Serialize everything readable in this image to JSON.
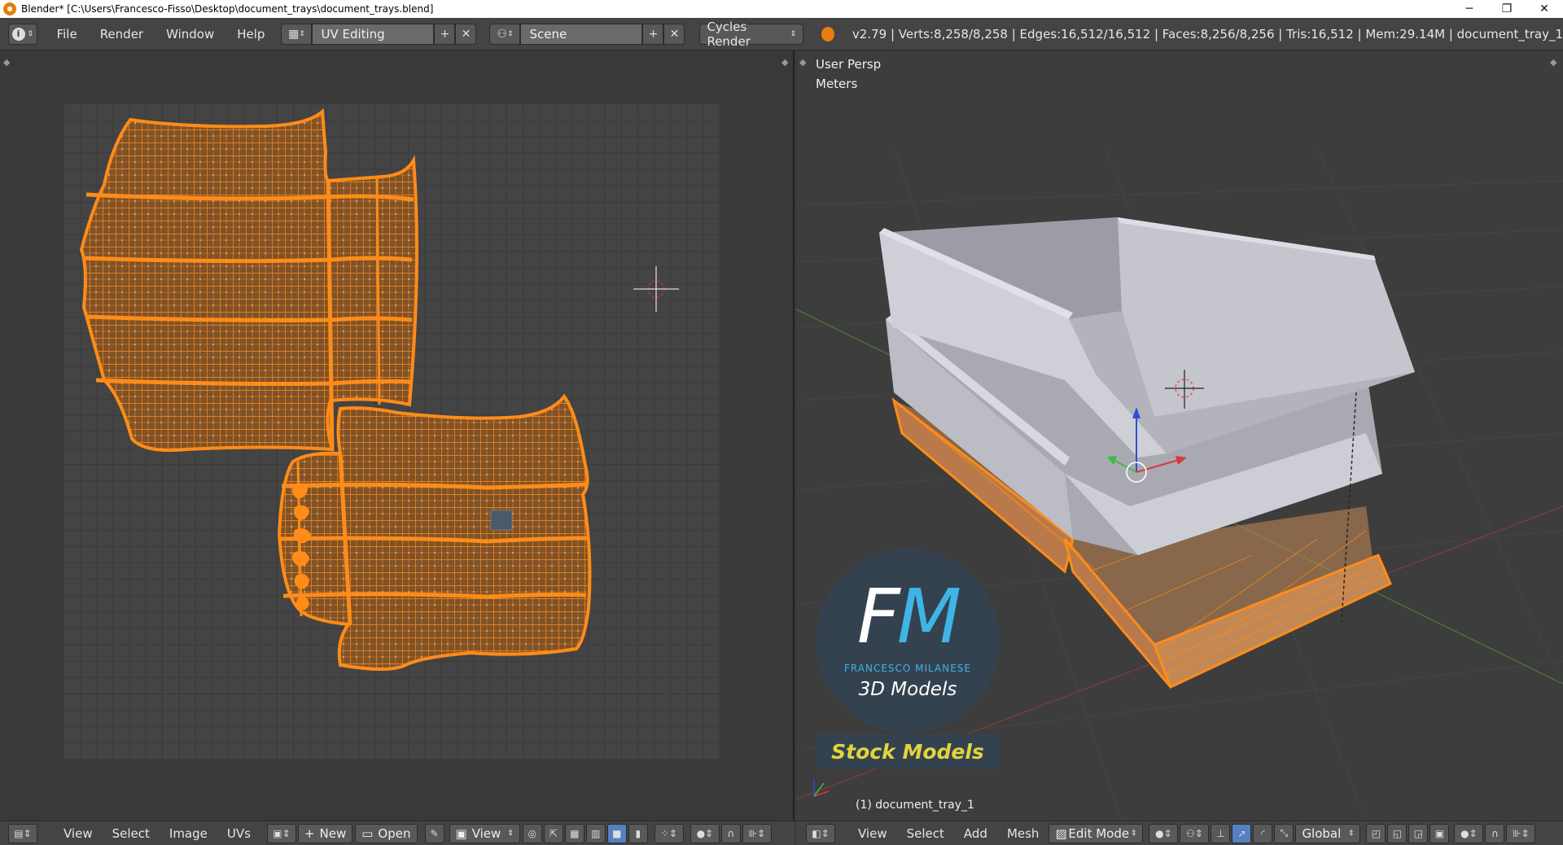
{
  "window": {
    "title": "Blender* [C:\\Users\\Francesco-Fisso\\Desktop\\document_trays\\document_trays.blend]",
    "minimize": "─",
    "restore": "❐",
    "close": "✕"
  },
  "topbar": {
    "info_icon": "i",
    "menus": [
      "File",
      "Render",
      "Window",
      "Help"
    ],
    "screen_layout": "UV Editing",
    "scene": "Scene",
    "render_engine": "Cycles Render",
    "stats": "v2.79 | Verts:8,258/8,258 | Edges:16,512/16,512 | Faces:8,256/8,256 | Tris:16,512 | Mem:29.14M | document_tray_1"
  },
  "uv_editor": {
    "menus": [
      "View",
      "Select",
      "Image",
      "UVs"
    ],
    "new_label": "New",
    "open_label": "Open",
    "view_label": "View"
  },
  "viewport": {
    "view_name": "User Persp",
    "units": "Meters",
    "object_label": "(1) document_tray_1",
    "menus": [
      "View",
      "Select",
      "Add",
      "Mesh"
    ],
    "mode": "Edit Mode",
    "orientation": "Global"
  },
  "watermark": {
    "logo_f": "F",
    "logo_m": "M",
    "logo_name": "FRANCESCO MILANESE",
    "logo_sub": "3D Models",
    "badge": "Stock Models"
  },
  "colors": {
    "selection": "#ff8c19",
    "face_fill": "#8a5a2c",
    "tray_gray": "#b8b8bf",
    "logo_blue": "#3fb4e6",
    "badge_yellow": "#e3d43b"
  }
}
